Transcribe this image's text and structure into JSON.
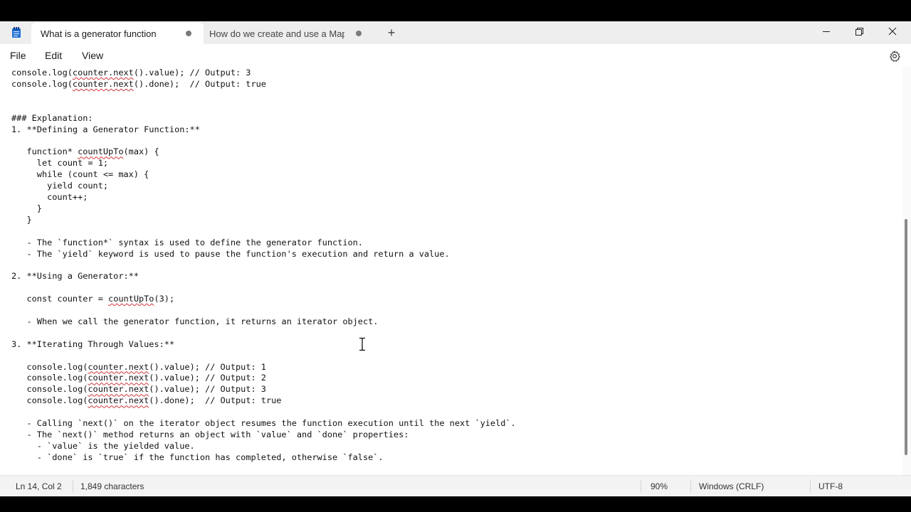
{
  "tabs": [
    {
      "title": "What is a generator function",
      "active": true
    },
    {
      "title": "How do we create and use a Map ar",
      "active": false
    }
  ],
  "new_tab_label": "+",
  "menu": [
    "File",
    "Edit",
    "View"
  ],
  "editor": {
    "lines": [
      "console.log(counter.next().value); // Output: 3",
      "console.log(counter.next().done);  // Output: true",
      "",
      "",
      "### Explanation:",
      "1. **Defining a Generator Function:**",
      "",
      "   function* countUpTo(max) {",
      "     let count = 1;",
      "     while (count <= max) {",
      "       yield count;",
      "       count++;",
      "     }",
      "   }",
      "",
      "   - The `function*` syntax is used to define the generator function.",
      "   - The `yield` keyword is used to pause the function's execution and return a value.",
      "",
      "2. **Using a Generator:**",
      "",
      "   const counter = countUpTo(3);",
      "",
      "   - When we call the generator function, it returns an iterator object.",
      "",
      "3. **Iterating Through Values:**",
      "",
      "   console.log(counter.next().value); // Output: 1",
      "   console.log(counter.next().value); // Output: 2",
      "   console.log(counter.next().value); // Output: 3",
      "   console.log(counter.next().done);  // Output: true",
      "",
      "   - Calling `next()` on the iterator object resumes the function execution until the next `yield`.",
      "   - The `next()` method returns an object with `value` and `done` properties:",
      "     - `value` is the yielded value.",
      "     - `done` is `true` if the function has completed, otherwise `false`."
    ],
    "misspelled": [
      "counter.next",
      "countUpTo"
    ]
  },
  "status": {
    "position": "Ln 14, Col 2",
    "characters": "1,849 characters",
    "zoom": "90%",
    "line_ending": "Windows (CRLF)",
    "encoding": "UTF-8"
  },
  "colors": {
    "titlebar": "#eeeeee",
    "statusbar": "#f3f3f3",
    "spellcheck": "#d13438",
    "app_icon": "#1f6fd1"
  },
  "icons": {
    "app": "notepad-icon",
    "minimize": "minimize-icon",
    "maximize": "restore-icon",
    "close": "close-icon",
    "settings": "gear-icon",
    "text_cursor": "ibeam-cursor-icon"
  }
}
